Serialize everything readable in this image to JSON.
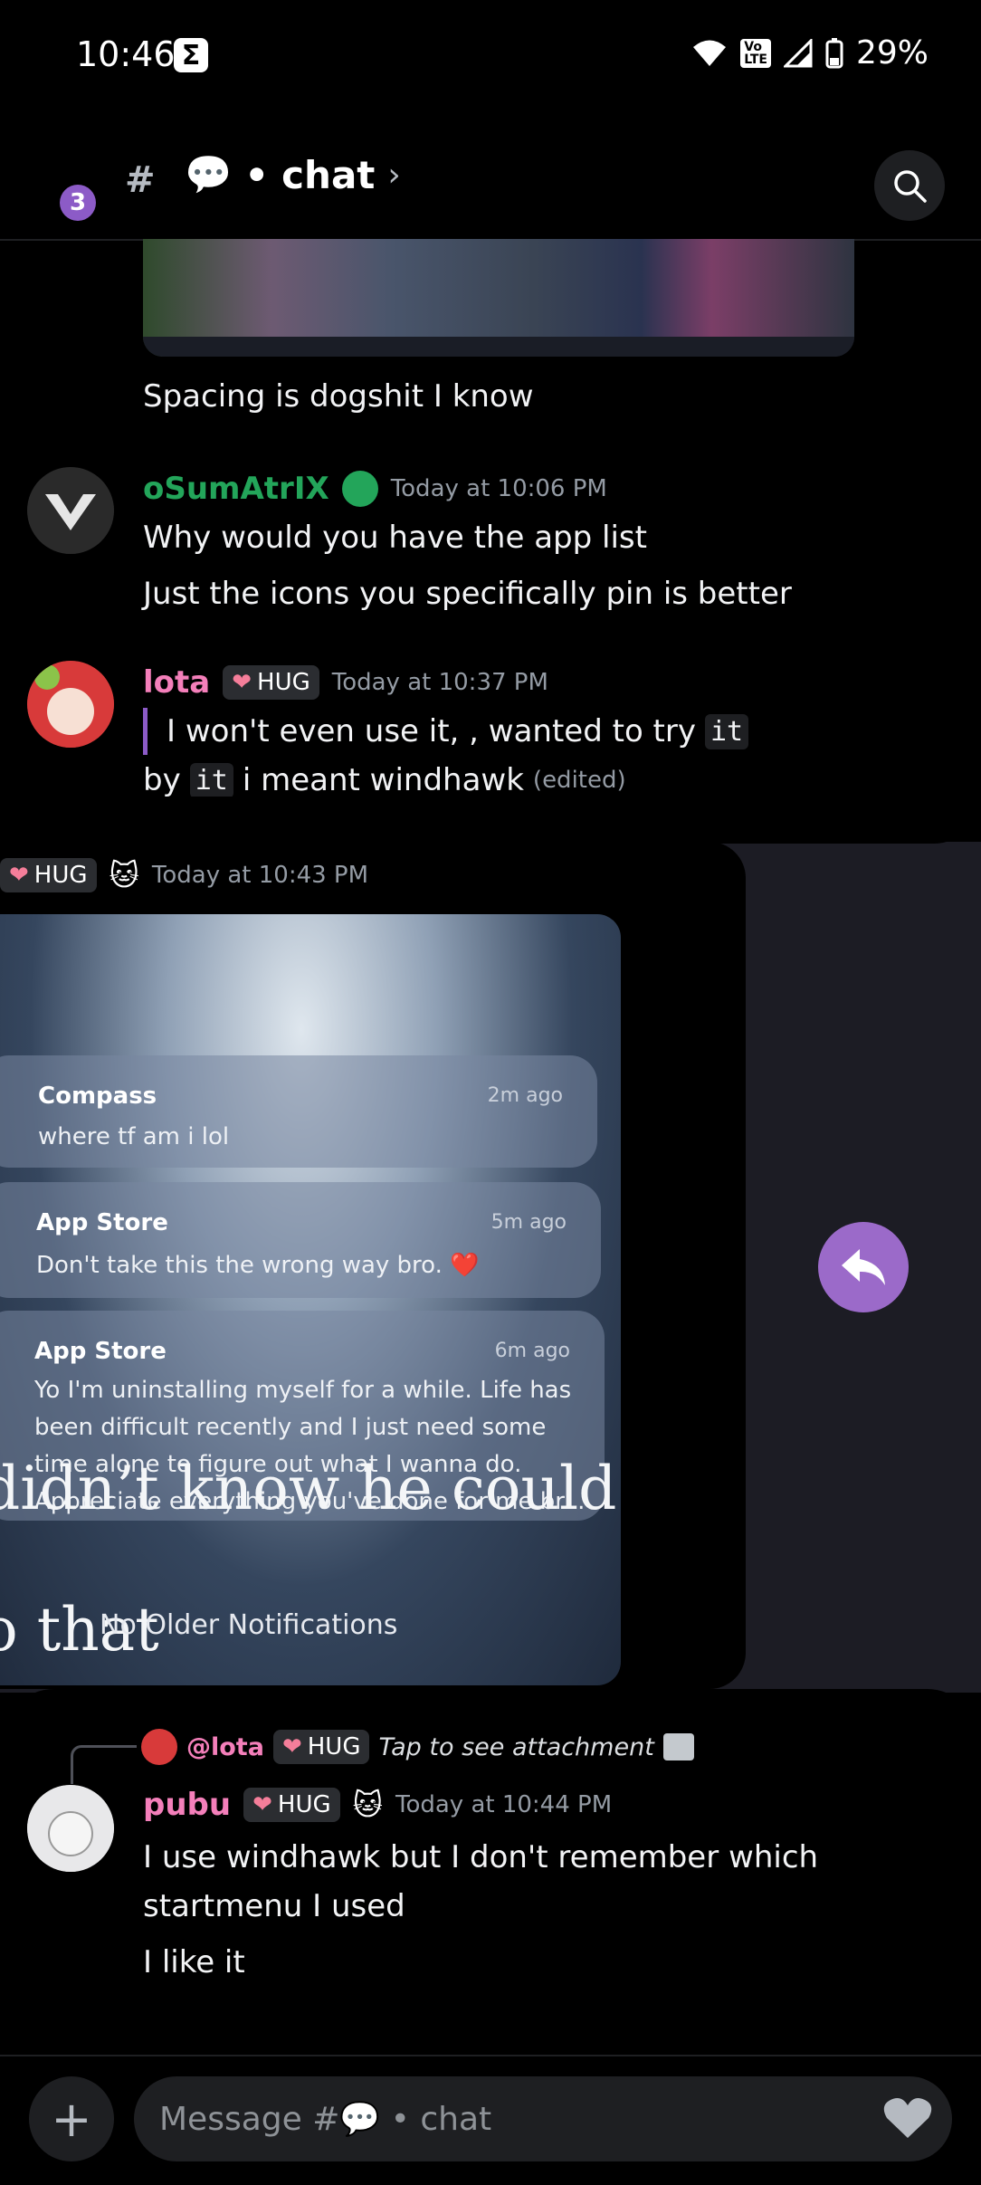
{
  "status_bar": {
    "time": "10:46",
    "battery": "29%",
    "volte": "Vo\nLTE"
  },
  "header": {
    "badge_count": "3",
    "title": "chat",
    "separator": "•"
  },
  "messages": [
    {
      "text": "Spacing is dogshit I know"
    },
    {
      "username": "oSumAtrIX",
      "username_color": "#23a55a",
      "timestamp": "Today at 10:06 PM",
      "lines": [
        "Why would you have the app list",
        "Just the icons you specifically pin is better"
      ]
    },
    {
      "username": "lota",
      "username_color": "#f47fba",
      "tag": "HUG",
      "timestamp": "Today at 10:37 PM",
      "quote_text": "I won't even use it, , wanted to try",
      "quote_code": "it",
      "line2_pre": "by",
      "line2_code": "it",
      "line2_post": "i meant windhawk",
      "edited": "(edited)"
    },
    {
      "tag": "HUG",
      "timestamp": "Today at 10:43 PM"
    },
    {
      "username": "pubu",
      "username_color": "#f47fba",
      "tag": "HUG",
      "timestamp": "Today at 10:44 PM",
      "reply_mention": "@lota",
      "reply_tag": "HUG",
      "reply_text": "Tap to see attachment",
      "lines": [
        "I use windhawk but I don't remember which",
        "startmenu I used",
        "I like it"
      ]
    }
  ],
  "notifications": [
    {
      "app": "Compass",
      "time": "2m ago",
      "body": "where tf am i lol"
    },
    {
      "app": "App Store",
      "time": "5m ago",
      "body": "Don't take this the wrong way bro. ❤️"
    },
    {
      "app": "App Store",
      "time": "6m ago",
      "lines": [
        "Yo I'm uninstalling myself for a while. Life has",
        "been difficult recently and I just need some",
        "time alone to figure out what I wanna do.",
        "Appreciate everything you've done for me br..."
      ]
    }
  ],
  "meme_text": {
    "line1": "didn’t know he could",
    "line2": "o that"
  },
  "no_older": "No Older Notifications",
  "input": {
    "placeholder": "Message #💬 • chat"
  },
  "colors": {
    "accent": "#9b6ac9",
    "green_name": "#23a55a",
    "pink_name": "#f47fba"
  }
}
